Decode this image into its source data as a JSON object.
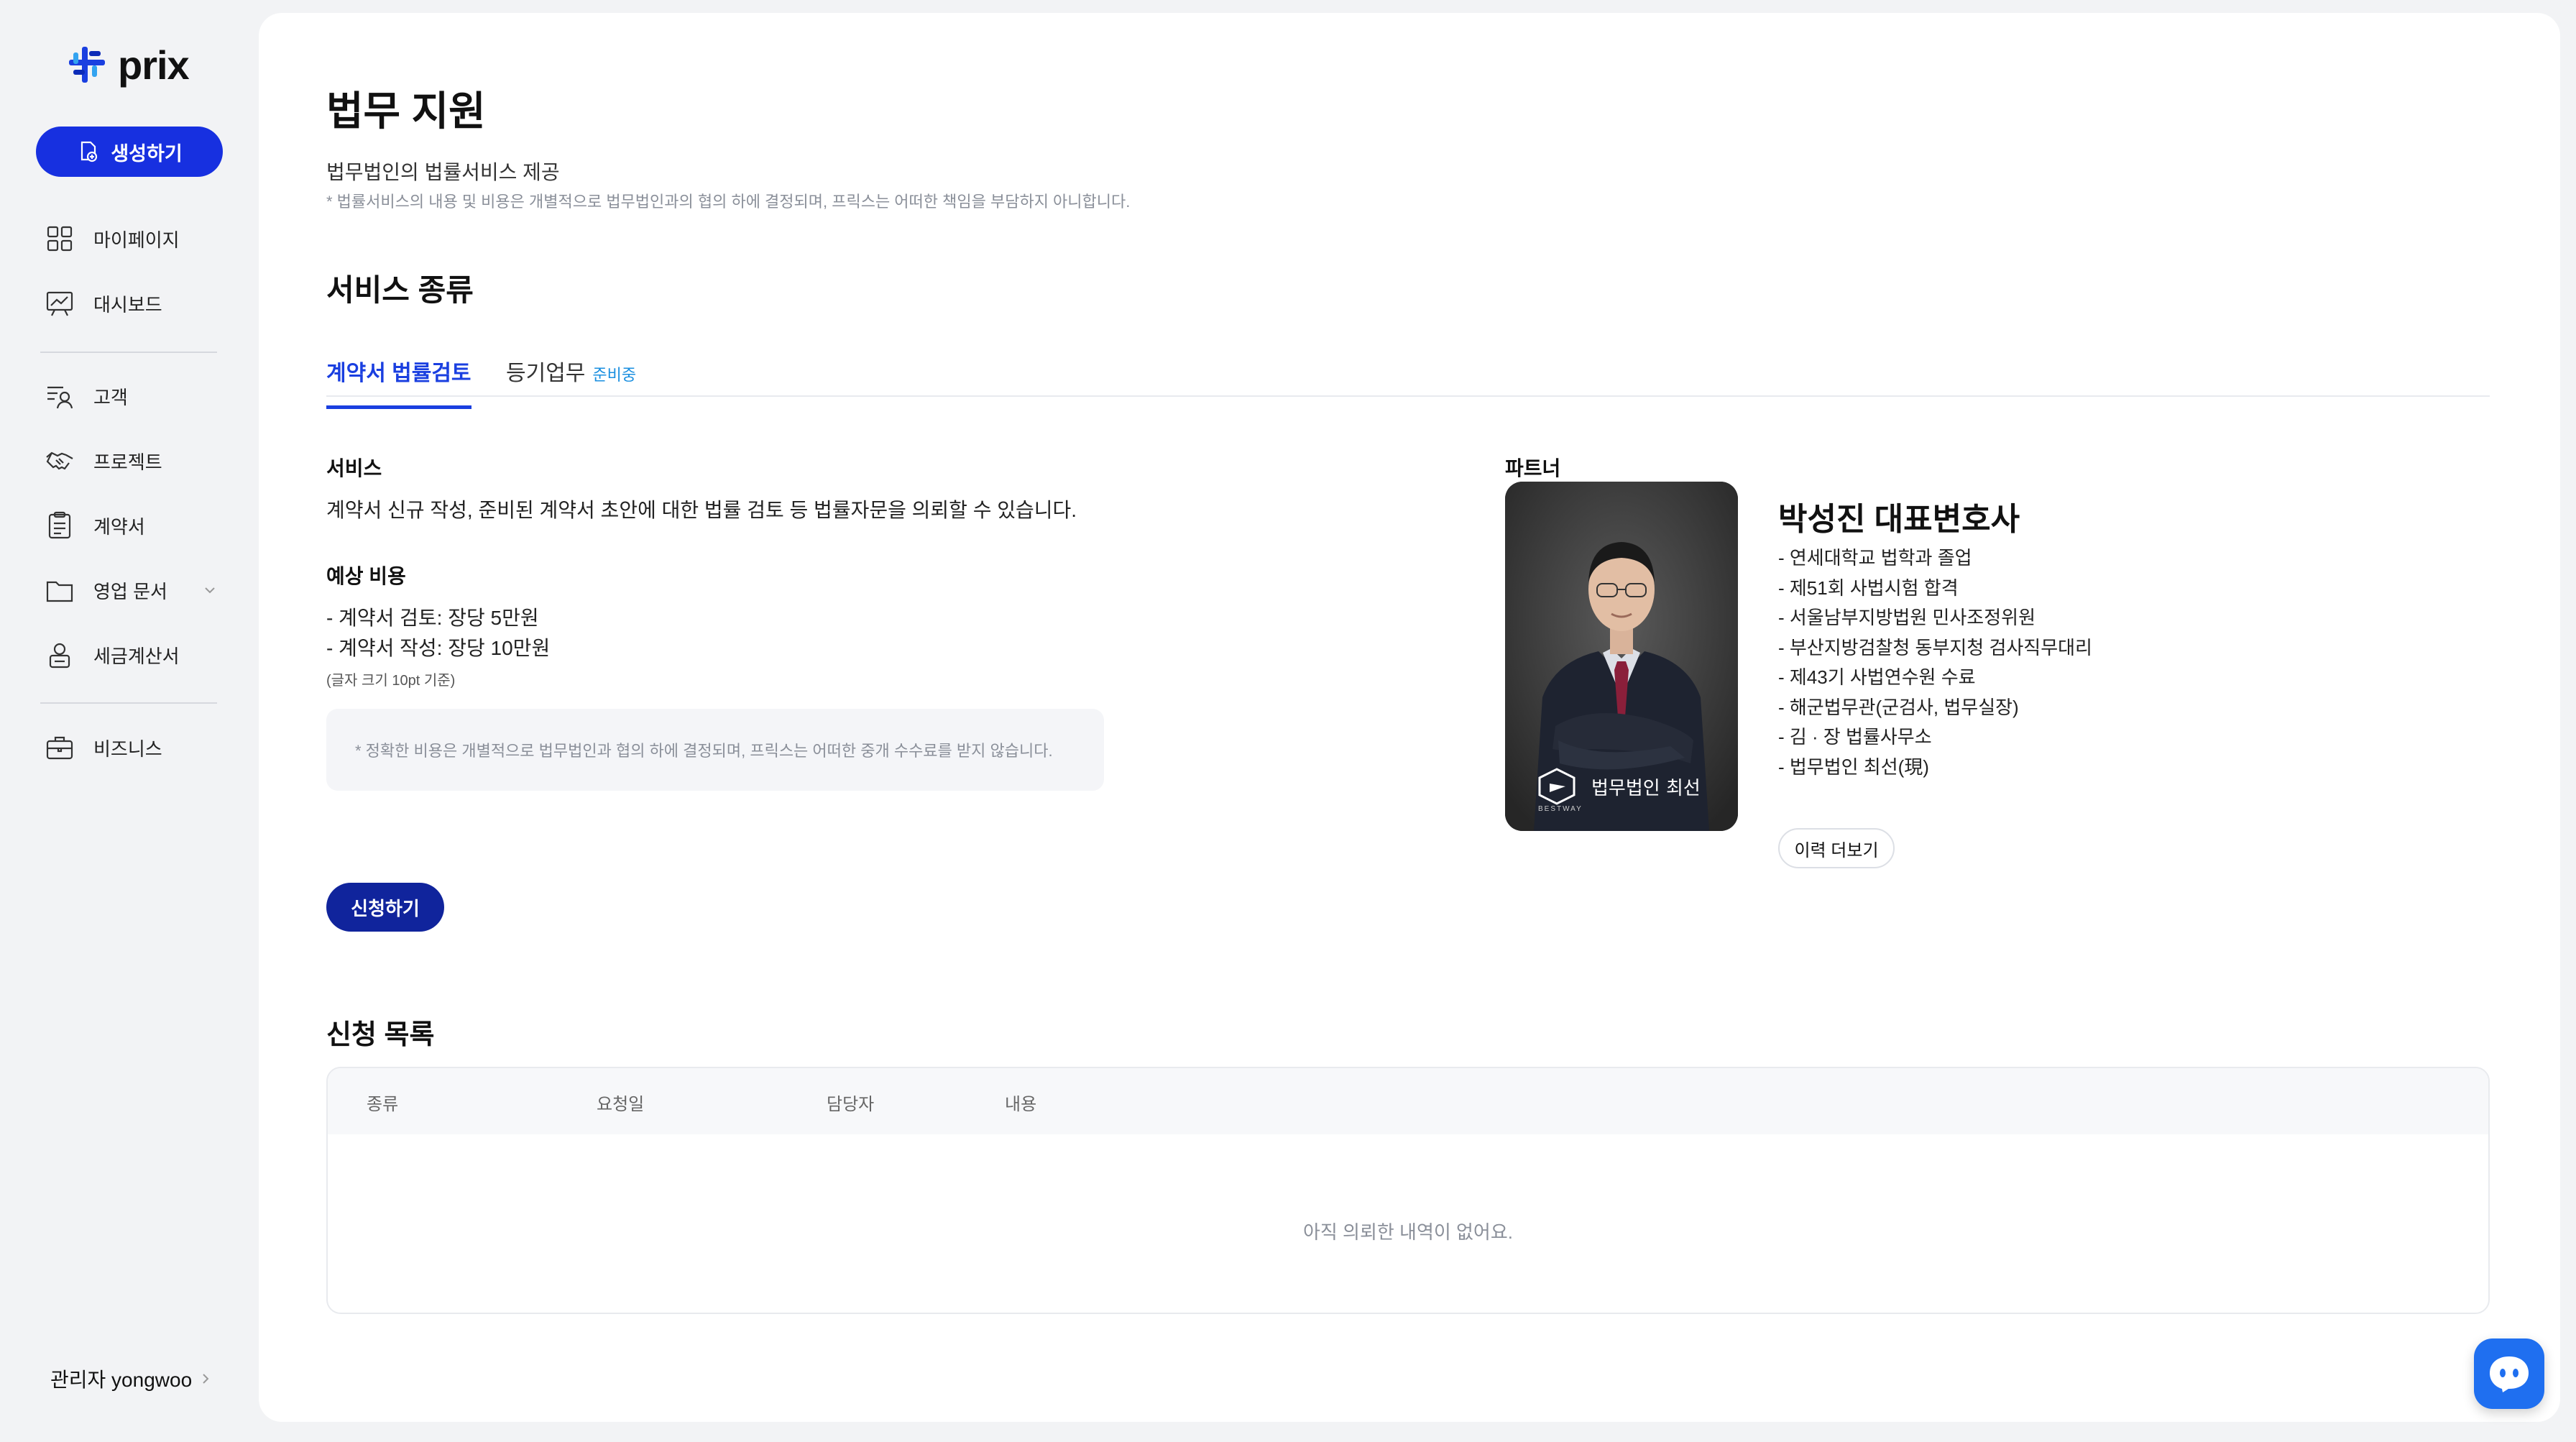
{
  "app": {
    "logo_text": "prix"
  },
  "sidebar": {
    "create_label": "생성하기",
    "items": [
      {
        "label": "마이페이지",
        "icon": "grid-icon"
      },
      {
        "label": "대시보드",
        "icon": "chart-board-icon"
      },
      {
        "label": "고객",
        "icon": "customer-list-icon"
      },
      {
        "label": "프로젝트",
        "icon": "handshake-icon"
      },
      {
        "label": "계약서",
        "icon": "clipboard-icon"
      },
      {
        "label": "영업 문서",
        "icon": "folder-icon"
      },
      {
        "label": "세금계산서",
        "icon": "tax-invoice-icon"
      },
      {
        "label": "비즈니스",
        "icon": "briefcase-icon"
      }
    ],
    "admin_label": "관리자 yongwoo"
  },
  "page": {
    "title": "법무 지원",
    "subtitle": "법무법인의 법률서비스 제공",
    "note": "* 법률서비스의 내용 및 비용은 개별적으로 법무법인과의 협의 하에 결정되며, 프릭스는 어떠한 책임을 부담하지 아니합니다."
  },
  "service_types": {
    "title": "서비스 종류",
    "tabs": [
      {
        "label": "계약서 법률검토",
        "active": true
      },
      {
        "label": "등기업무",
        "badge": "준비중"
      }
    ]
  },
  "service": {
    "label": "서비스",
    "description": "계약서 신규 작성, 준비된 계약서 초안에 대한 법률 검토 등 법률자문을 의뢰할 수 있습니다.",
    "cost_label": "예상 비용",
    "cost_lines": [
      "- 계약서 검토: 장당 5만원",
      "- 계약서 작성: 장당 10만원"
    ],
    "cost_note": "(글자 크기 10pt 기준)",
    "box_note": "* 정확한 비용은 개별적으로 법무법인과 협의 하에 결정되며, 프릭스는 어떠한 중개 수수료를 받지 않습니다.",
    "apply_label": "신청하기"
  },
  "partner": {
    "label": "파트너",
    "name": "박성진 대표변호사",
    "photo_caption": "법무법인 최선",
    "photo_mark": "BESTWAY",
    "career": [
      "- 연세대학교 법학과 졸업",
      "- 제51회 사법시험 합격",
      "- 서울남부지방법원 민사조정위원",
      "- 부산지방검찰청 동부지청 검사직무대리",
      "- 제43기 사법연수원 수료",
      "- 해군법무관(군검사, 법무실장)",
      "- 김 · 장 법률사무소",
      "- 법무법인 최선(現)"
    ],
    "more_label": "이력 더보기"
  },
  "applications": {
    "title": "신청 목록",
    "columns": [
      "종류",
      "요청일",
      "담당자",
      "내용"
    ],
    "empty_text": "아직 의뢰한 내역이 없어요."
  },
  "colors": {
    "primary": "#1730e0",
    "apply_button": "#10249c",
    "tab_active": "#1a3fe0",
    "badge": "#1a8fe0",
    "chat_button": "#1f6ff0"
  }
}
